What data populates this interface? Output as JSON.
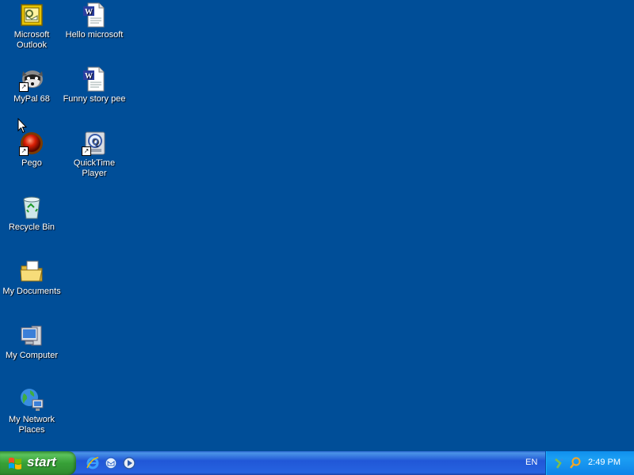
{
  "desktop": {
    "background": "#004E98",
    "icons": [
      {
        "label": "Microsoft Outlook",
        "icon": "outlook-icon"
      },
      {
        "label": "Hello microsoft",
        "icon": "word-document-icon"
      },
      {
        "label": "MyPal 68",
        "icon": "raccoon-browser-icon"
      },
      {
        "label": "Funny story pee",
        "icon": "word-document-icon"
      },
      {
        "label": "Pego",
        "icon": "red-ball-icon"
      },
      {
        "label": "QuickTime Player",
        "icon": "quicktime-icon"
      },
      {
        "label": "Recycle Bin",
        "icon": "recycle-bin-icon"
      },
      {
        "label": "My Documents",
        "icon": "folder-icon"
      },
      {
        "label": "My Computer",
        "icon": "computer-icon"
      },
      {
        "label": "My Network Places",
        "icon": "network-globe-icon"
      }
    ]
  },
  "taskbar": {
    "start_label": "start",
    "quick_launch": [
      "internet-explorer-icon",
      "outlook-express-icon",
      "media-player-icon"
    ],
    "language": "EN",
    "clock": "2:49 PM",
    "tray_icons": [
      "network-connection-icon",
      "search-icon"
    ]
  }
}
